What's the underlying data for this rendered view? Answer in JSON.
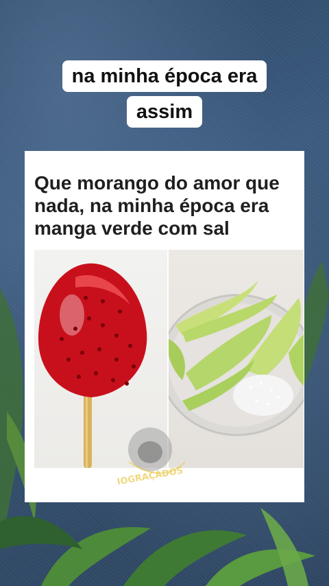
{
  "caption": {
    "line1": "na minha época era",
    "line2": "assim"
  },
  "card": {
    "text": "Que morango do amor que nada, na minha época era manga verde com sal"
  },
  "images": {
    "left": "strawberry-candy-icon",
    "right": "green-mango-with-salt-icon"
  },
  "watermark": {
    "text": "IOGRAÇADOS",
    "icon": "dog-mascot-icon"
  },
  "colors": {
    "background": "#34506f",
    "caption_bg": "#ffffff",
    "strawberry": "#c8101c",
    "mango": "#b8d86a",
    "watermark": "#e8c84a"
  }
}
